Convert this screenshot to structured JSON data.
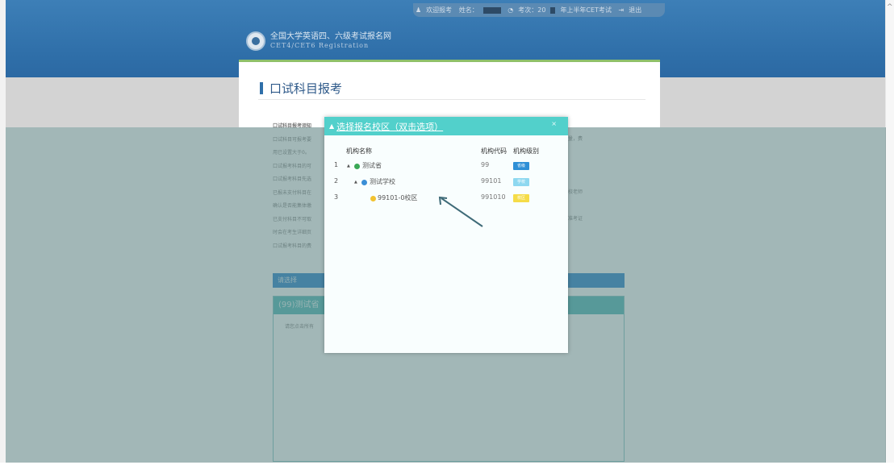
{
  "topbar": {
    "item1": "欢迎报考",
    "item2": "姓名：",
    "item3": "考次：20",
    "item4": "年上半年CET考试",
    "item5": "退出"
  },
  "site": {
    "title_cn": "全国大学英语四、六级考试报名网",
    "title_en": "CET4/CET6  Registration"
  },
  "page": {
    "section_title": "口试科目报考",
    "notes_heading": "口试科目报考须知",
    "notes": [
      "口试科目可报考要",
      "用已设置大于0。",
      "口试报考科目的可",
      "口试报考科目先选",
      "已报未支付科目在",
      "确认是否能集体缴",
      "已支付科目不可取",
      "时会在考生详细页",
      "口试报考科目的费"
    ],
    "notes_right": [
      "员，有剩余容量，费",
      "",
      "",
      "",
      "询，请联系学校老师",
      "",
      "准在可以打印准考证"
    ],
    "blue_bar": "请选择",
    "school_name": "(99)测试省",
    "school_hint": "请您点击所有"
  },
  "modal": {
    "title": "选择报名校区（双击选项）",
    "close_label": "×",
    "columns": [
      "机构名称",
      "机构代码",
      "机构级别"
    ],
    "rows": [
      {
        "num": "1",
        "name": "测试省",
        "code": "99",
        "level": "省级",
        "dot_color": "#3aa856",
        "badge_color": "#2f8fd6"
      },
      {
        "num": "2",
        "name": "测试学校",
        "code": "99101",
        "level": "学校",
        "dot_color": "#3b8ed6",
        "badge_color": "#8ed8f0"
      },
      {
        "num": "3",
        "name": "99101-0校区",
        "code": "991010",
        "level": "校区",
        "dot_color": "#f2c230",
        "badge_color": "#f5dc48"
      }
    ]
  },
  "colors": {
    "header_blue": "#2f6fa9",
    "modal_header": "#52d0cb",
    "overlay": "#3c6969"
  }
}
